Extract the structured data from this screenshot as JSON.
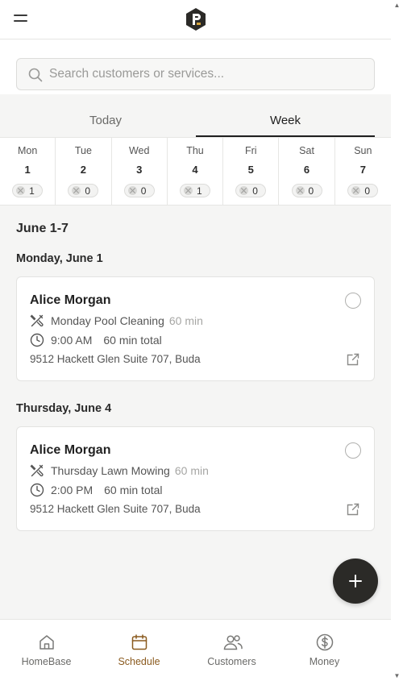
{
  "search": {
    "placeholder": "Search customers or services..."
  },
  "tabs": [
    {
      "label": "Today"
    },
    {
      "label": "Week"
    }
  ],
  "week": [
    {
      "day": "Mon",
      "num": "1",
      "count": "1"
    },
    {
      "day": "Tue",
      "num": "2",
      "count": "0"
    },
    {
      "day": "Wed",
      "num": "3",
      "count": "0"
    },
    {
      "day": "Thu",
      "num": "4",
      "count": "1"
    },
    {
      "day": "Fri",
      "num": "5",
      "count": "0"
    },
    {
      "day": "Sat",
      "num": "6",
      "count": "0"
    },
    {
      "day": "Sun",
      "num": "7",
      "count": "0"
    }
  ],
  "range_title": "June 1-7",
  "groups": [
    {
      "date": "Monday, June 1",
      "job": {
        "customer": "Alice Morgan",
        "service": "Monday Pool Cleaning",
        "service_duration": "60 min",
        "time": "9:00 AM",
        "total": "60 min total",
        "address": "9512 Hackett Glen Suite 707, Buda"
      }
    },
    {
      "date": "Thursday, June 4",
      "job": {
        "customer": "Alice Morgan",
        "service": "Thursday Lawn Mowing",
        "service_duration": "60 min",
        "time": "2:00 PM",
        "total": "60 min total",
        "address": "9512 Hackett Glen Suite 707, Buda"
      }
    }
  ],
  "nav": [
    {
      "label": "HomeBase",
      "icon": "home-icon"
    },
    {
      "label": "Schedule",
      "icon": "calendar-icon",
      "active": true
    },
    {
      "label": "Customers",
      "icon": "users-icon"
    },
    {
      "label": "Money",
      "icon": "dollar-circle-icon"
    }
  ],
  "colors": {
    "accent": "#8a5a1e",
    "fab": "#2b2a27",
    "logo_bg": "#2b2a27",
    "logo_accent": "#d4a23a"
  }
}
